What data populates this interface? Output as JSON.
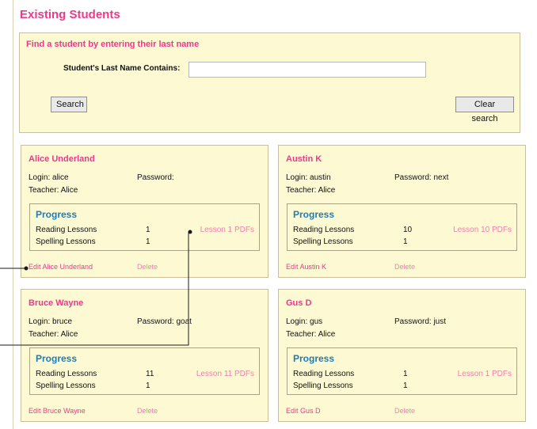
{
  "page": {
    "title": "Existing Students"
  },
  "search": {
    "heading": "Find a student by entering their last name",
    "label": "Student's Last Name Contains:",
    "value": "",
    "search_label": "Search",
    "clear_label": "Clear search"
  },
  "students": [
    {
      "name": "Alice Underland",
      "login": "Login: alice",
      "password": "Password:",
      "teacher": "Teacher: Alice",
      "progress_title": "Progress",
      "reading_label": "Reading Lessons",
      "reading_count": "1",
      "reading_pdf": "Lesson 1 PDFs",
      "spelling_label": "Spelling Lessons",
      "spelling_count": "1",
      "edit": "Edit Alice Underland",
      "delete": "Delete"
    },
    {
      "name": "Austin K",
      "login": "Login: austin",
      "password": "Password: next",
      "teacher": "Teacher: Alice",
      "progress_title": "Progress",
      "reading_label": "Reading Lessons",
      "reading_count": "10",
      "reading_pdf": "Lesson 10 PDFs",
      "spelling_label": "Spelling Lessons",
      "spelling_count": "1",
      "edit": "Edit Austin K",
      "delete": "Delete"
    },
    {
      "name": "Bruce Wayne",
      "login": "Login: bruce",
      "password": "Password: goat",
      "teacher": "Teacher: Alice",
      "progress_title": "Progress",
      "reading_label": "Reading Lessons",
      "reading_count": "11",
      "reading_pdf": "Lesson 11 PDFs",
      "spelling_label": "Spelling Lessons",
      "spelling_count": "1",
      "edit": "Edit Bruce Wayne",
      "delete": "Delete"
    },
    {
      "name": "Gus D",
      "login": "Login: gus",
      "password": "Password: just",
      "teacher": "Teacher: Alice",
      "progress_title": "Progress",
      "reading_label": "Reading Lessons",
      "reading_count": "1",
      "reading_pdf": "Lesson 1 PDFs",
      "spelling_label": "Spelling Lessons",
      "spelling_count": "1",
      "edit": "Edit Gus D",
      "delete": "Delete"
    }
  ],
  "colors": {
    "accent_pink": "#ec3a8b",
    "link_pink": "#f37fb1",
    "progress_blue": "#1f7cb4",
    "panel_yellow": "#fdf9d2"
  }
}
